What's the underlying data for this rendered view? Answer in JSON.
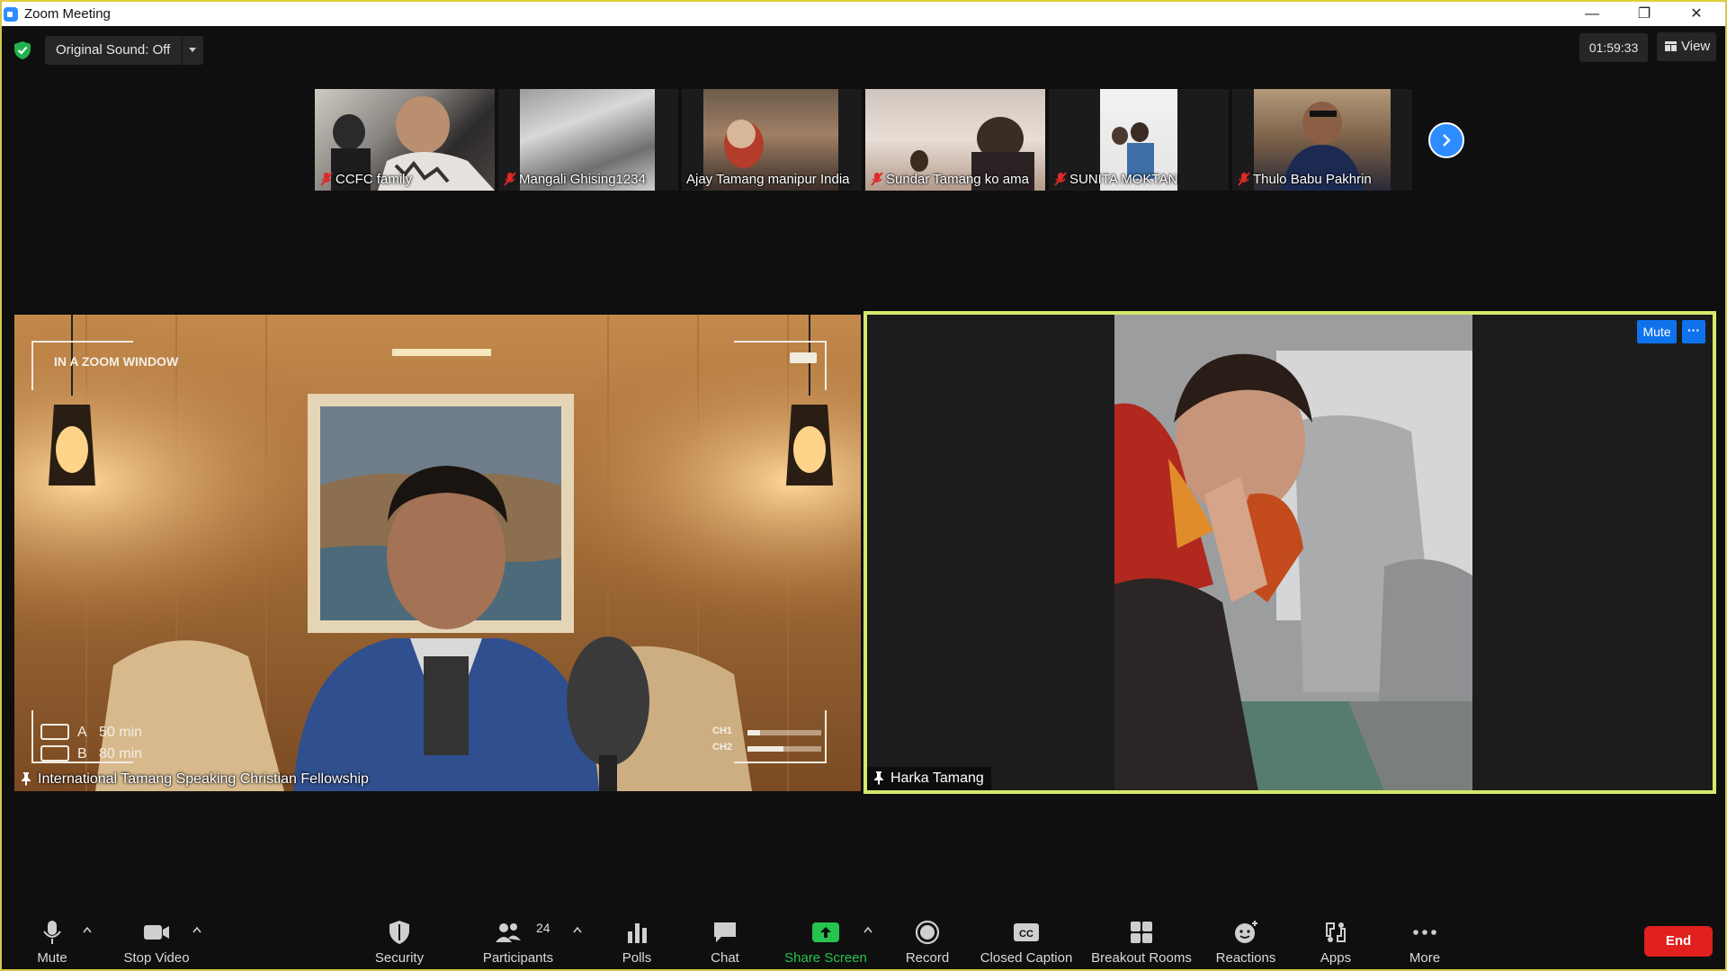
{
  "window": {
    "title": "Zoom Meeting"
  },
  "topbar": {
    "original_sound": "Original Sound: Off",
    "timer": "01:59:33",
    "view_label": "View"
  },
  "thumbnails": [
    {
      "name": "CCFC family",
      "muted": true
    },
    {
      "name": "Mangali  Ghising1234",
      "muted": true
    },
    {
      "name": "Ajay Tamang manipur India",
      "muted": false
    },
    {
      "name": "Sundar Tamang ko ama",
      "muted": true
    },
    {
      "name": "SUNITA  MOKTAN",
      "muted": true
    },
    {
      "name": "Thulo Babu Pakhrin",
      "muted": true
    }
  ],
  "main_tiles": {
    "left": {
      "name": "International Tamang Speaking Christian Fellowship",
      "overlay": {
        "title": "IN A ZOOM WINDOW",
        "a_label": "A",
        "a_value": "50 min",
        "b_label": "B",
        "b_value": "80 min",
        "ch1": "CH1",
        "ch2": "CH2"
      }
    },
    "right": {
      "name": "Harka Tamang",
      "mute_label": "Mute",
      "more_label": "···"
    }
  },
  "toolbar": {
    "mute": "Mute",
    "stop_video": "Stop Video",
    "security": "Security",
    "participants": "Participants",
    "participant_count": "24",
    "polls": "Polls",
    "chat": "Chat",
    "share_screen": "Share Screen",
    "record": "Record",
    "closed_caption": "Closed Caption",
    "cc_badge": "CC",
    "breakout_rooms": "Breakout Rooms",
    "reactions": "Reactions",
    "apps": "Apps",
    "more": "More",
    "end": "End"
  },
  "colors": {
    "accent_blue": "#0e72ed",
    "active_speaker": "#d3ea6a",
    "share_green": "#26c34e",
    "end_red": "#e0211e"
  }
}
